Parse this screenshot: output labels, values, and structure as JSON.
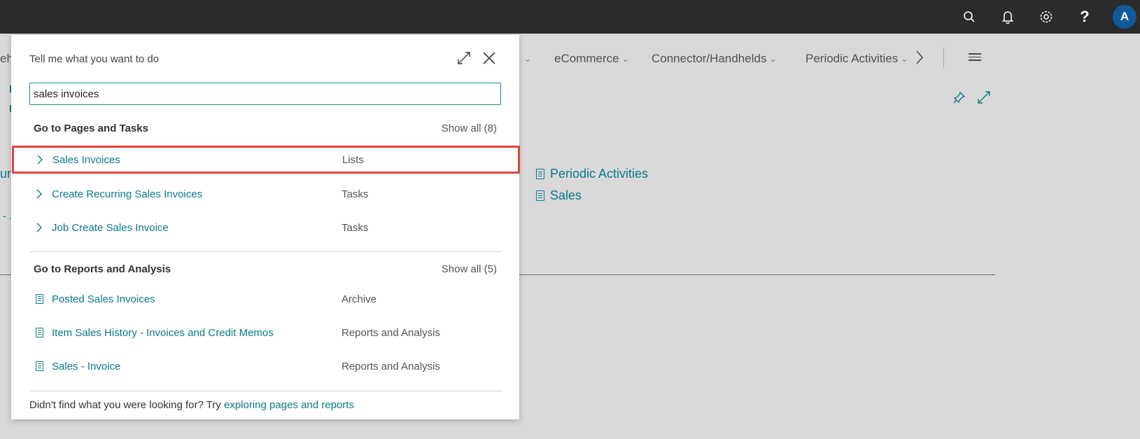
{
  "topbar": {
    "icons": [
      "search-icon",
      "bell-icon",
      "gear-icon",
      "help-icon"
    ],
    "help_glyph": "?",
    "avatar_initial": "A",
    "avatar_color": "#0f5a9c"
  },
  "background": {
    "nav_fragment": "eh",
    "nav": [
      "eCommerce",
      "Connector/Handhelds",
      "Periodic Activities"
    ],
    "links": [
      "Periodic Activities",
      "Sales"
    ],
    "left_fragments": [
      "ur",
      "- ."
    ]
  },
  "dialog": {
    "title": "Tell me what you want to do",
    "search_value": "sales invoices",
    "groups": [
      {
        "title": "Go to Pages and Tasks",
        "show_all": "Show all (8)",
        "items": [
          {
            "label": "Sales Invoices",
            "category": "Lists",
            "icon": "chevron-right-icon",
            "selected": true
          },
          {
            "label": "Create Recurring Sales Invoices",
            "category": "Tasks",
            "icon": "chevron-right-icon"
          },
          {
            "label": "Job Create Sales Invoice",
            "category": "Tasks",
            "icon": "chevron-right-icon"
          }
        ]
      },
      {
        "title": "Go to Reports and Analysis",
        "show_all": "Show all (5)",
        "items": [
          {
            "label": "Posted Sales Invoices",
            "category": "Archive",
            "icon": "report-icon"
          },
          {
            "label": "Item Sales History - Invoices and Credit Memos",
            "category": "Reports and Analysis",
            "icon": "report-icon"
          },
          {
            "label": "Sales - Invoice",
            "category": "Reports and Analysis",
            "icon": "report-icon"
          }
        ]
      }
    ],
    "footer_text": "Didn't find what you were looking for? Try ",
    "footer_link": "exploring pages and reports"
  },
  "colors": {
    "accent": "#0a7a8a",
    "highlight_border": "#e0443a",
    "topbar": "#2b2b2b"
  }
}
